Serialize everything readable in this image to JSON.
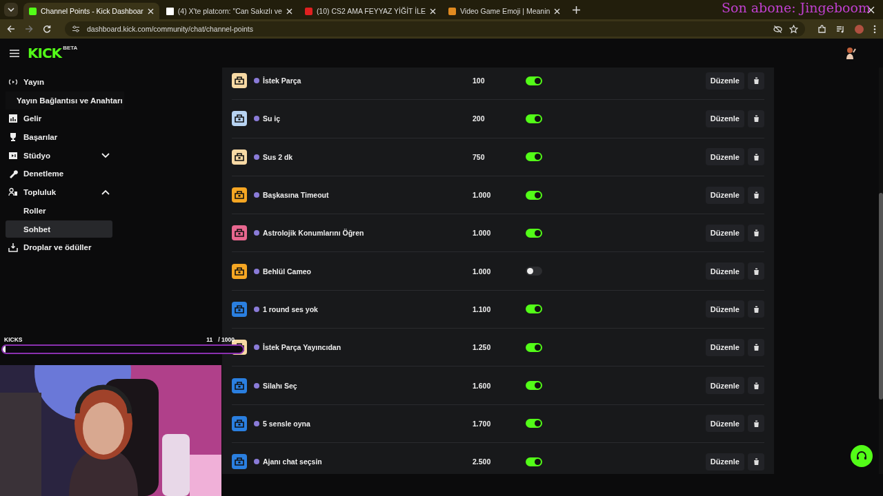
{
  "browser": {
    "tabs": [
      {
        "title": "Channel Points - Kick Dashboar",
        "selected": true
      },
      {
        "title": "(4) X'te platcorn: \"Can Sakızlı ve",
        "selected": false
      },
      {
        "title": "(10) CS2 AMA FEYYAZ YİĞİT İLE",
        "selected": false
      },
      {
        "title": "Video Game Emoji | Meanin",
        "selected": false
      }
    ],
    "url": "dashboard.kick.com/community/chat/channel-points"
  },
  "header": {
    "logo": "KICK",
    "badge": "BETA"
  },
  "sidebar": {
    "items": [
      {
        "label": "Yayın",
        "kind": "section"
      },
      {
        "label": "Yayın Bağlantısı ve Anahtarı",
        "kind": "link"
      },
      {
        "label": "Gelir",
        "kind": "section"
      },
      {
        "label": "Başarılar",
        "kind": "section"
      },
      {
        "label": "Stüdyo",
        "kind": "section",
        "expanded": false
      },
      {
        "label": "Denetleme",
        "kind": "section"
      },
      {
        "label": "Topluluk",
        "kind": "section",
        "expanded": true,
        "children": [
          {
            "label": "Roller",
            "selected": false
          },
          {
            "label": "Sohbet",
            "selected": true
          }
        ]
      },
      {
        "label": "Droplar ve ödüller",
        "kind": "section"
      }
    ]
  },
  "rewards": [
    {
      "name": "İstek Parça",
      "cost": "100",
      "enabled": true,
      "color": "#f7d9a4",
      "edit_label": "Düzenle"
    },
    {
      "name": "Su iç",
      "cost": "200",
      "enabled": true,
      "color": "#b7d3f2",
      "edit_label": "Düzenle"
    },
    {
      "name": "Sus 2 dk",
      "cost": "750",
      "enabled": true,
      "color": "#f7d9a4",
      "edit_label": "Düzenle"
    },
    {
      "name": "Başkasına Timeout",
      "cost": "1.000",
      "enabled": true,
      "color": "#f5a623",
      "edit_label": "Düzenle"
    },
    {
      "name": "Astrolojik Konumlarını Öğren",
      "cost": "1.000",
      "enabled": true,
      "color": "#e8678f",
      "edit_label": "Düzenle"
    },
    {
      "name": "Behlül Cameo",
      "cost": "1.000",
      "enabled": false,
      "color": "#f5a623",
      "edit_label": "Düzenle"
    },
    {
      "name": "1 round ses yok",
      "cost": "1.100",
      "enabled": true,
      "color": "#2a7fe0",
      "edit_label": "Düzenle"
    },
    {
      "name": "İstek Parça Yayıncıdan",
      "cost": "1.250",
      "enabled": true,
      "color": "#f7d9a4",
      "edit_label": "Düzenle"
    },
    {
      "name": "Silahı Seç",
      "cost": "1.600",
      "enabled": true,
      "color": "#2a7fe0",
      "edit_label": "Düzenle"
    },
    {
      "name": "5 sensle oyna",
      "cost": "1.700",
      "enabled": true,
      "color": "#2a7fe0",
      "edit_label": "Düzenle"
    },
    {
      "name": "Ajanı chat seçsin",
      "cost": "2.500",
      "enabled": true,
      "color": "#2a7fe0",
      "edit_label": "Düzenle"
    }
  ],
  "overlay": {
    "last_sub": "Son abone: Jingeboom",
    "kicks_label": "KICKS",
    "kicks_count": "11",
    "kicks_goal": "/ 1000",
    "level": 0.011
  }
}
